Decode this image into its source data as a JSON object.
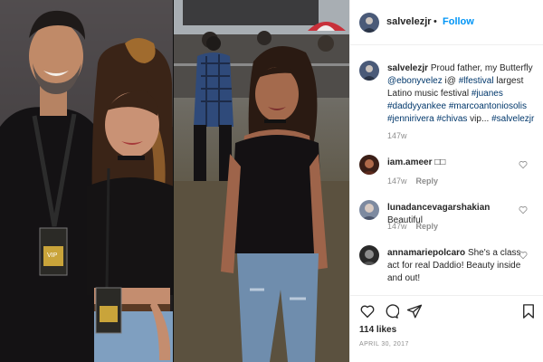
{
  "post": {
    "username": "salvelezjr",
    "separator": "•",
    "follow_label": "Follow"
  },
  "caption": {
    "username": "salvelezjr",
    "text_1": "Proud father, my Butterfly",
    "mention": "@ebonyvelez",
    "text_2": "i@",
    "tag_1": "#lfestival",
    "text_3": "largest Latino music festival",
    "tag_2": "#juanes",
    "tag_3": "#daddyyankee",
    "tag_4": "#marcoantoniosolis",
    "tag_5": "#jennirivera",
    "tag_6": "#chivas",
    "text_4": "vip...",
    "tag_7": "#salvelezjr",
    "time": "147w"
  },
  "comments": [
    {
      "username": "iam.ameer",
      "text": "□□",
      "time": "147w",
      "reply_label": "Reply"
    },
    {
      "username": "lunadancevagarshakian",
      "text": "Beautiful",
      "time": "147w",
      "reply_label": "Reply"
    },
    {
      "username": "annamariepolcaro",
      "text": "She's a class act for real Daddio! Beauty inside and out!",
      "time": "",
      "reply_label": ""
    }
  ],
  "actions": {
    "likes": "114 likes",
    "date": "April 30, 2017",
    "icons": [
      "heart-icon",
      "comment-icon",
      "share-icon",
      "bookmark-icon"
    ]
  },
  "colors": {
    "accent": "#0095f6",
    "link": "#00376b",
    "muted": "#8e8e8e",
    "border": "#efefef"
  }
}
